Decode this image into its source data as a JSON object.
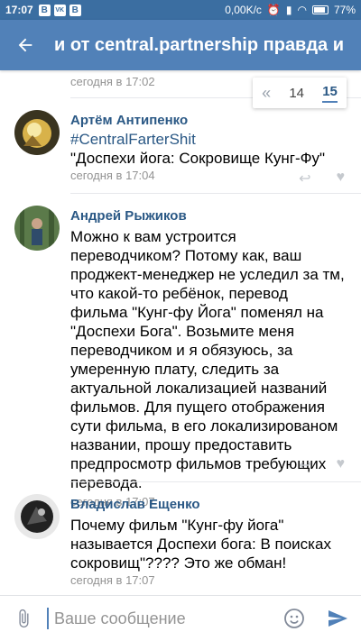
{
  "status_bar": {
    "time": "17:07",
    "app_icons": [
      "B",
      "VK",
      "B"
    ],
    "speed": "0,00K/c",
    "battery": "77%"
  },
  "toolbar": {
    "title": "и от central.partnership правда и"
  },
  "pager": {
    "first": "«",
    "prev_page": "14",
    "current_page": "15"
  },
  "comments": [
    {
      "author": "",
      "text": "",
      "time": "сегодня в 17:02"
    },
    {
      "author": "Артём Антипенко",
      "hashtag": "#CentralFarterShit",
      "text": "\"Доспехи йога: Сокровище Кунг-Фу\"",
      "time": "сегодня в 17:04"
    },
    {
      "author": "Андрей Рыжиков",
      "text": "Можно к вам устроится переводчиком? Потому как, ваш проджект-менеджер не уследил за тм, что какой-то ребёнок, перевод фильма \"Кунг-фу Йога\" поменял на \"Доспехи Бога\". Возьмите меня переводчиком и я обязуюсь, за умеренную плату, следить за актуальной локализацией названий фильмов. Для пущего отображения сути фильма, в его локализированом названии, прошу предоставить предпросмотр фильмов требующих перевода.",
      "time": "сегодня в 17:07"
    },
    {
      "author": "Владислав Ещенко",
      "text": "Почему фильм \"Кунг-фу йога\" называется Доспехи бога: В поисках сокровищ\"???? Это же обман!",
      "time": "сегодня в 17:07"
    }
  ],
  "compose": {
    "placeholder": "Ваше сообщение"
  },
  "colors": {
    "header": "#5181b8",
    "status_bar": "#3b6ea1",
    "link": "#2a5885"
  }
}
